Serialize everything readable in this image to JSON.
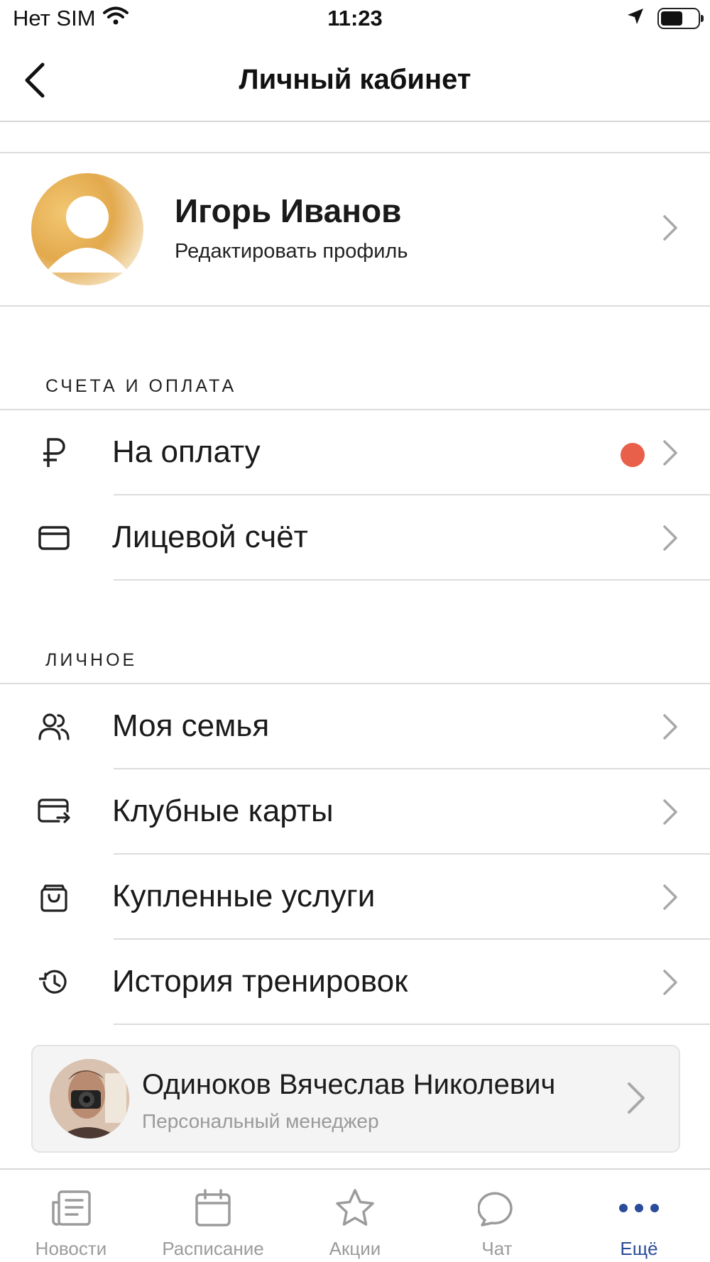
{
  "status_bar": {
    "carrier": "Нет SIM",
    "time": "11:23"
  },
  "nav": {
    "title": "Личный кабинет"
  },
  "profile": {
    "name": "Игорь Иванов",
    "subtitle": "Редактировать профиль"
  },
  "sections": {
    "billing": {
      "label": "СЧЕТА И ОПЛАТА",
      "items": [
        {
          "label": "На оплату",
          "icon": "ruble-icon",
          "has_badge": true
        },
        {
          "label": "Лицевой счёт",
          "icon": "card-icon"
        }
      ]
    },
    "personal": {
      "label": "ЛИЧНОЕ",
      "items": [
        {
          "label": "Моя семья",
          "icon": "people-icon"
        },
        {
          "label": "Клубные карты",
          "icon": "club-card-icon"
        },
        {
          "label": "Купленные услуги",
          "icon": "bag-icon"
        },
        {
          "label": "История тренировок",
          "icon": "history-icon"
        }
      ]
    }
  },
  "manager": {
    "name": "Одиноков Вячеслав Николевич",
    "role": "Персональный менеджер"
  },
  "tabs": [
    {
      "label": "Новости",
      "icon": "news-icon"
    },
    {
      "label": "Расписание",
      "icon": "calendar-icon"
    },
    {
      "label": "Акции",
      "icon": "star-icon"
    },
    {
      "label": "Чат",
      "icon": "chat-icon"
    },
    {
      "label": "Ещё",
      "icon": "more-icon",
      "active": true
    }
  ],
  "colors": {
    "accent": "#2b4c9a",
    "badge": "#e8604a",
    "inactive_tab": "#9b9b9b"
  }
}
